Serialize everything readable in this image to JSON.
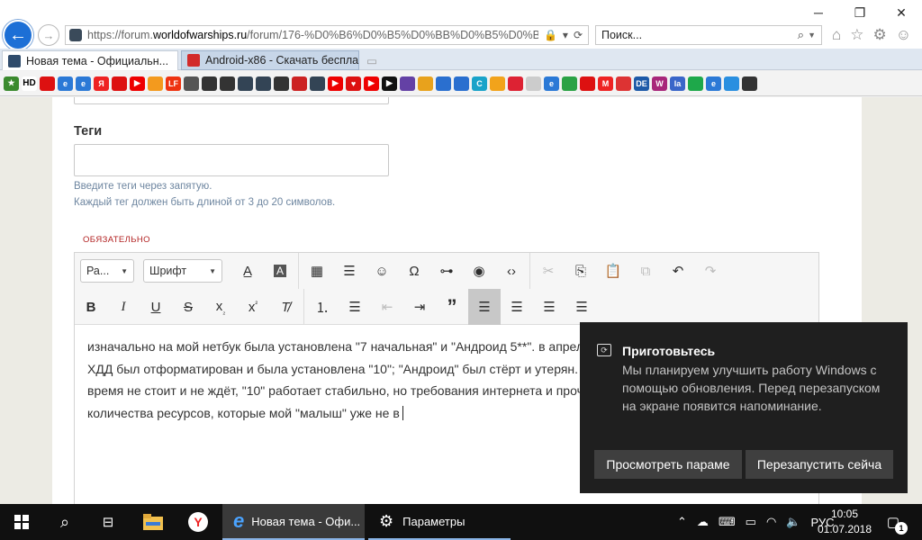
{
  "browser": {
    "url_prefix": "https://forum.",
    "url_host": "worldofwarships.ru",
    "url_rest": "/forum/176-%D0%B6%D0%B5%D0%BB%D0%B5%D0%B7%D0",
    "search_placeholder": "Поиск...",
    "tabs": [
      {
        "label": "Новая тема - Официальн...",
        "color": "#2f4b6b"
      },
      {
        "label": "Android-x86 - Скачать беспла...",
        "color": "#d22b2b"
      }
    ],
    "favorites": [
      {
        "icon": "star-icon",
        "color": "#3b8a2e",
        "text": "★"
      },
      {
        "icon": "hd-icon",
        "color": "#ffffff",
        "text": "HD"
      },
      {
        "icon": "red-square-icon",
        "color": "#d11",
        "text": ""
      },
      {
        "icon": "ie-icon",
        "color": "#2b79d6",
        "text": "e"
      },
      {
        "icon": "ie-icon",
        "color": "#2b79d6",
        "text": "e"
      },
      {
        "icon": "yandex-icon",
        "color": "#e22",
        "text": "Я"
      },
      {
        "icon": "lenta-icon",
        "color": "#d11",
        "text": ""
      },
      {
        "icon": "youtube-icon",
        "color": "#e00",
        "text": "▶"
      },
      {
        "icon": "orange-icon",
        "color": "#f39a1e",
        "text": ""
      },
      {
        "icon": "lf-icon",
        "color": "#e31",
        "text": "LF"
      },
      {
        "icon": "wolf-icon",
        "color": "#555",
        "text": ""
      },
      {
        "icon": "wot-icon",
        "color": "#333",
        "text": ""
      },
      {
        "icon": "wot-icon",
        "color": "#333",
        "text": ""
      },
      {
        "icon": "wows-icon",
        "color": "#345",
        "text": ""
      },
      {
        "icon": "wows-icon",
        "color": "#345",
        "text": ""
      },
      {
        "icon": "wot-icon",
        "color": "#333",
        "text": ""
      },
      {
        "icon": "red-circle-icon",
        "color": "#c22",
        "text": ""
      },
      {
        "icon": "wows-icon",
        "color": "#345",
        "text": ""
      },
      {
        "icon": "youtube-icon",
        "color": "#e00",
        "text": "▶"
      },
      {
        "icon": "heart-icon",
        "color": "#d11",
        "text": "♥"
      },
      {
        "icon": "youtube-icon",
        "color": "#e00",
        "text": "▶"
      },
      {
        "icon": "play-icon",
        "color": "#111",
        "text": "▶"
      },
      {
        "icon": "twitch-icon",
        "color": "#6441a5",
        "text": ""
      },
      {
        "icon": "ring-icon",
        "color": "#e8a21c",
        "text": ""
      },
      {
        "icon": "photo-icon",
        "color": "#2a6fcf",
        "text": ""
      },
      {
        "icon": "photo-icon",
        "color": "#2a6fcf",
        "text": ""
      },
      {
        "icon": "c-icon",
        "color": "#1aa3c9",
        "text": "C"
      },
      {
        "icon": "mail-icon",
        "color": "#f2a31b",
        "text": ""
      },
      {
        "icon": "red-icon",
        "color": "#d23",
        "text": ""
      },
      {
        "icon": "diamond-icon",
        "color": "#ccc",
        "text": ""
      },
      {
        "icon": "ie-icon",
        "color": "#2b79d6",
        "text": "e"
      },
      {
        "icon": "leaf-icon",
        "color": "#2ba245",
        "text": ""
      },
      {
        "icon": "plug-icon",
        "color": "#d11",
        "text": ""
      },
      {
        "icon": "m-icon",
        "color": "#e22",
        "text": "M"
      },
      {
        "icon": "box-icon",
        "color": "#d33",
        "text": ""
      },
      {
        "icon": "de-icon",
        "color": "#1e5aa8",
        "text": "DE"
      },
      {
        "icon": "w-icon",
        "color": "#a8267a",
        "text": "W"
      },
      {
        "icon": "la-icon",
        "color": "#3a66c9",
        "text": "la"
      },
      {
        "icon": "sber-icon",
        "color": "#1ea84a",
        "text": ""
      },
      {
        "icon": "ie-icon",
        "color": "#2b79d6",
        "text": "e"
      },
      {
        "icon": "drop-icon",
        "color": "#2a8fe0",
        "text": ""
      },
      {
        "icon": "multi-icon",
        "color": "#333",
        "text": ""
      }
    ]
  },
  "form": {
    "tags_label": "Теги",
    "tags_value": "",
    "tags_hint_1": "Введите теги через запятую.",
    "tags_hint_2": "Каждый тег должен быть длиной от 3 до 20 символов.",
    "required_label": "ОБЯЗАТЕЛЬНО"
  },
  "editor": {
    "format_select": "Ра...",
    "font_select": "Шрифт",
    "body_lines": [
      "изначально на мой нетбук была установлена \"7 начальная\" и \"Андроид 5**\". в апреле",
      "ХДД был отформатирован и была установлена \"10\"; \"Андроид\" был стёрт и утерян.",
      "время не стоит и не ждёт, \"10\" работает стабильно, но требования интернета и прочих",
      "количества ресурсов, которые мой \"малыш\" уже не в"
    ]
  },
  "toast": {
    "title": "Приготовьтесь",
    "message": "Мы планируем улучшить работу Windows с помощью обновления. Перед перезапуском на экране появится напоминание.",
    "button_1": "Просмотреть параме",
    "button_2": "Перезапустить сейча"
  },
  "taskbar": {
    "ie_label": "Новая тема - Офи...",
    "settings_label": "Параметры",
    "language": "РУС",
    "time": "10:05",
    "date": "01.07.2018",
    "notifications": "1"
  }
}
